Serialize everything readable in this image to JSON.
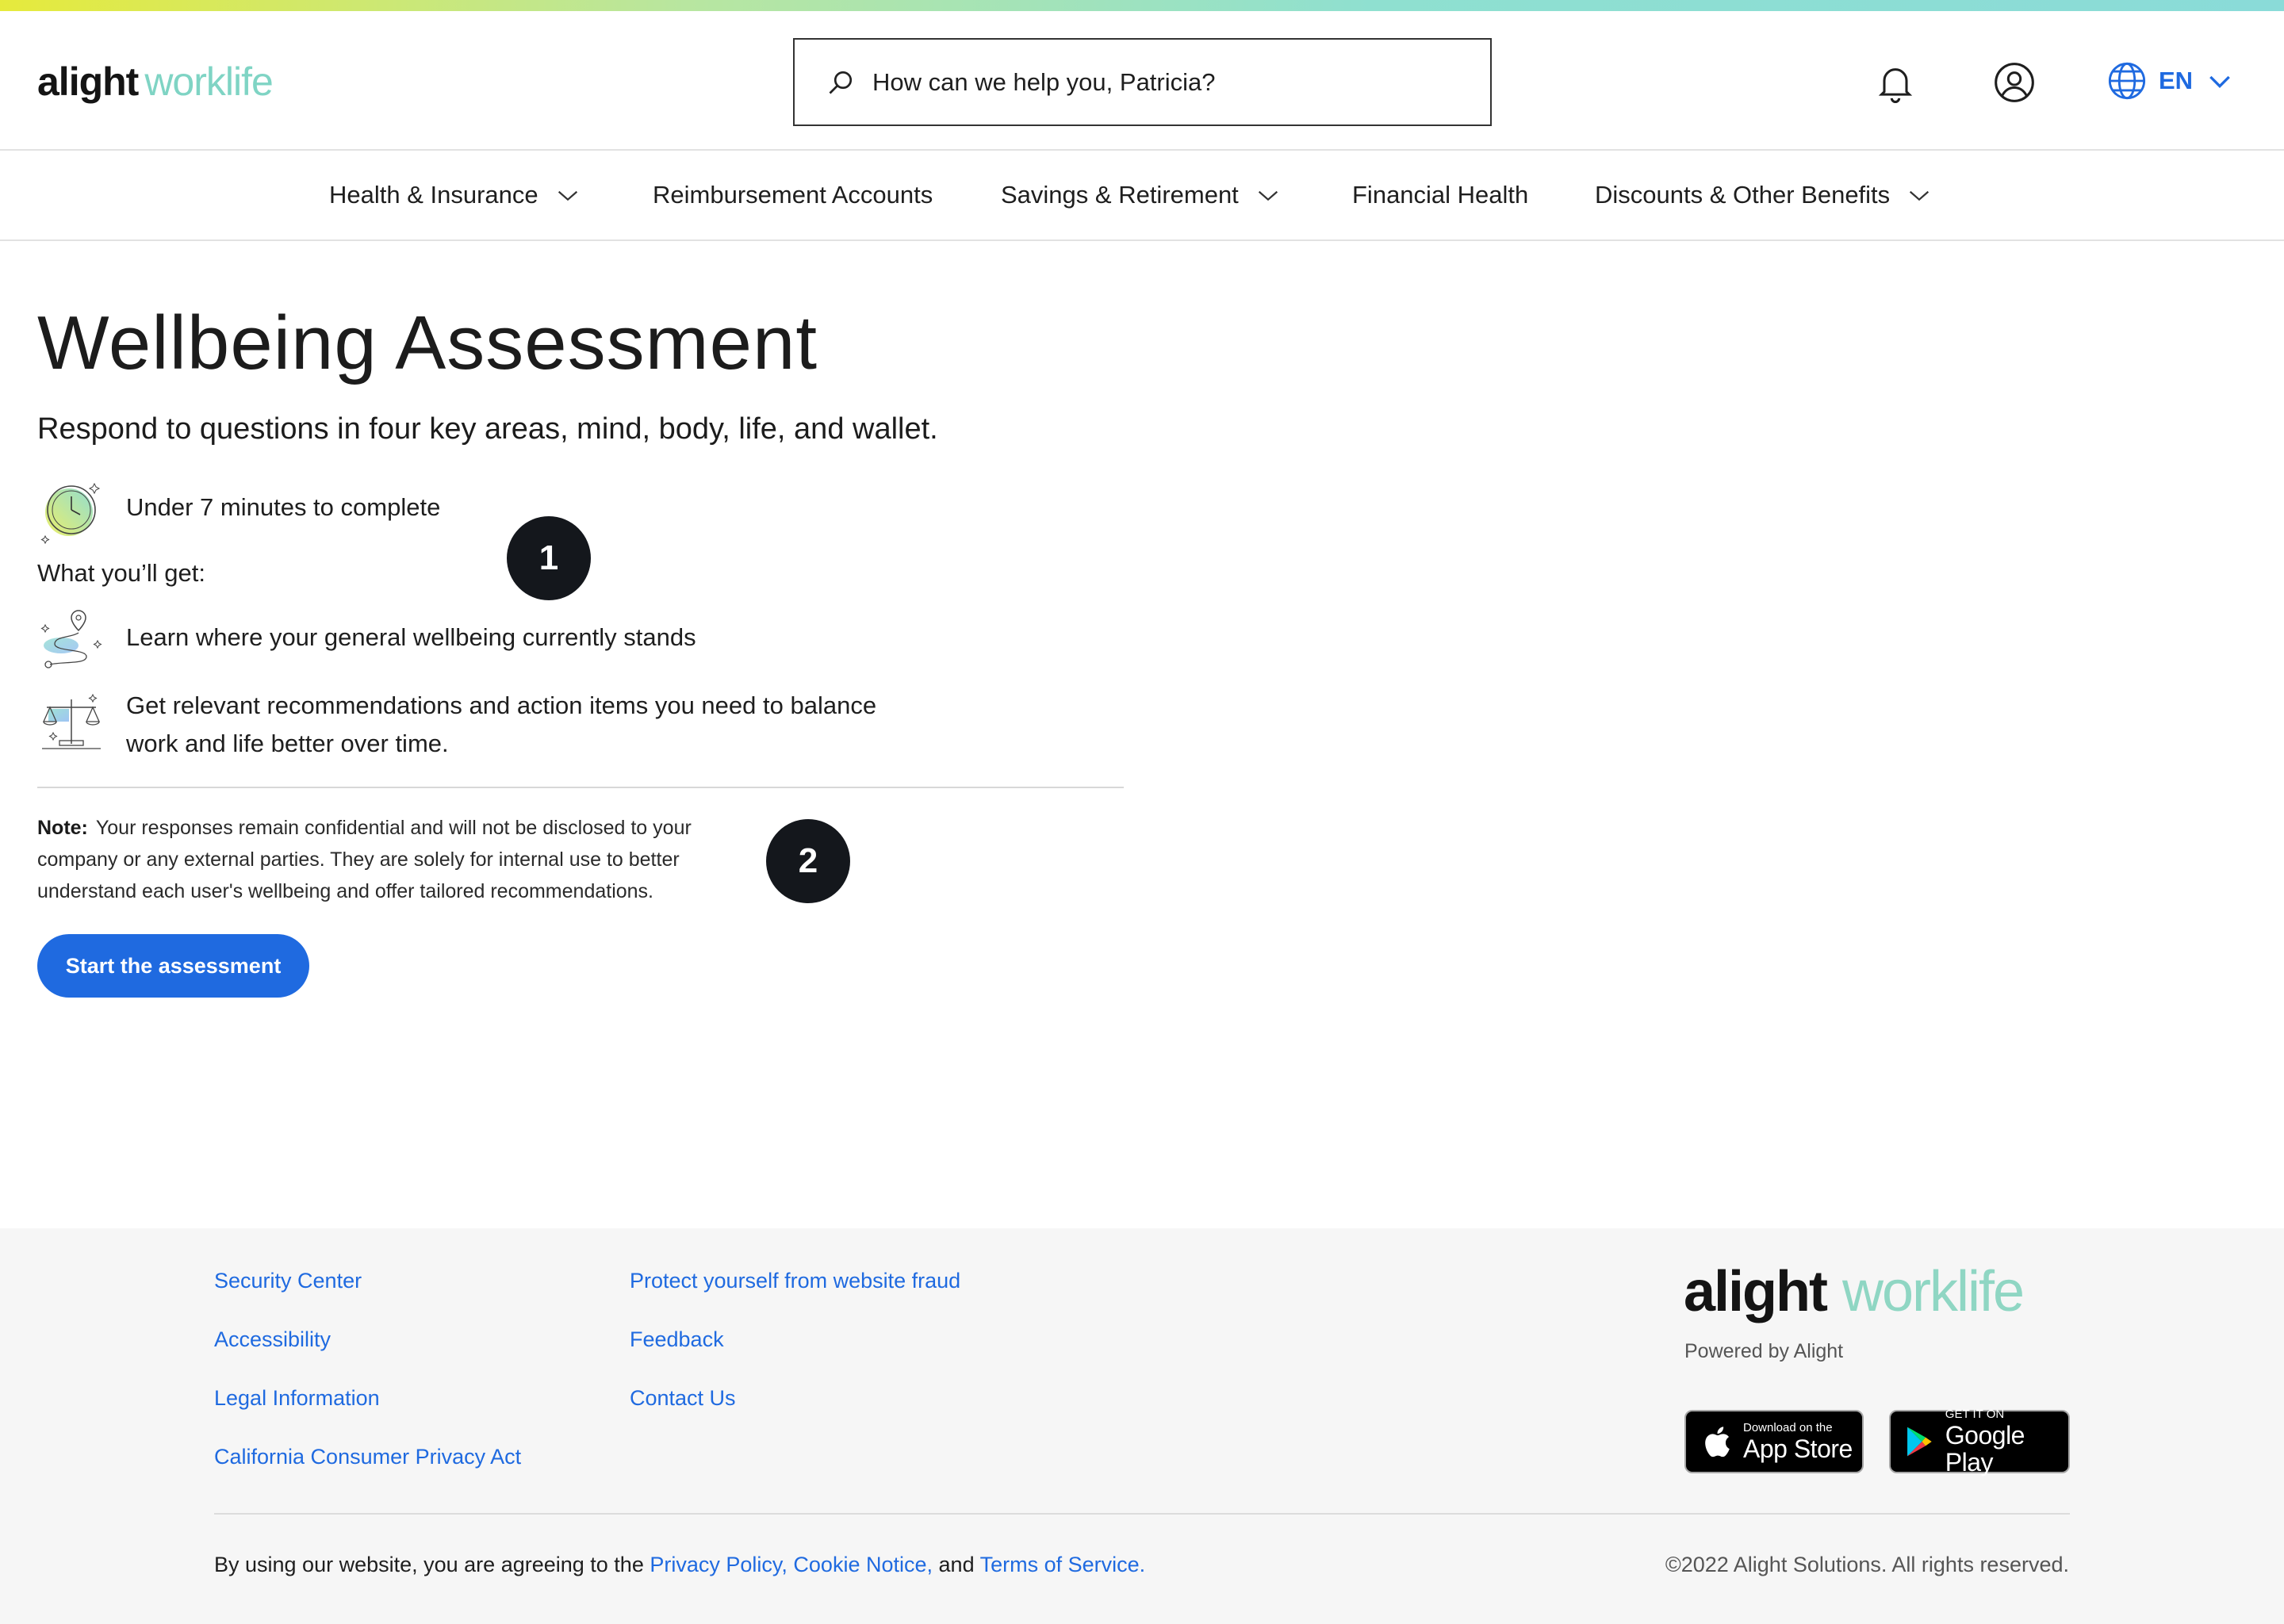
{
  "brand": {
    "alight": "alight",
    "worklife": "worklife"
  },
  "header": {
    "search_placeholder": "How can we help you, Patricia?",
    "language": "EN"
  },
  "nav": {
    "items": [
      {
        "label": "Health & Insurance",
        "has_dropdown": true
      },
      {
        "label": "Reimbursement Accounts",
        "has_dropdown": false
      },
      {
        "label": "Savings & Retirement",
        "has_dropdown": true
      },
      {
        "label": "Financial Health",
        "has_dropdown": false
      },
      {
        "label": "Discounts & Other Benefits",
        "has_dropdown": true
      }
    ]
  },
  "main": {
    "title": "Wellbeing Assessment",
    "lead": "Respond to questions in four key areas, mind, body, life, and wallet.",
    "time_text": "Under 7 minutes to complete",
    "get_label": "What you’ll get:",
    "benefits": [
      "Learn where your general wellbeing currently stands",
      "Get relevant recommendations and action items you need to balance work and life better over time."
    ],
    "benefit_2_line1": "Get relevant recommendations and action items you need to balance",
    "benefit_2_line2": "work and life better over time.",
    "note_label": "Note:",
    "note_text": "Your responses remain confidential and will not be disclosed to your company or any external parties. They are solely for internal use to better understand each user's wellbeing and offer tailored recommendations.",
    "note_line1": "Your responses remain confidential and will not be disclosed to your",
    "note_line2": "company or any external parties. They are solely for internal use to better",
    "note_line3": "understand each user's wellbeing and offer tailored recommendations.",
    "cta": "Start the assessment",
    "markers": [
      "1",
      "2"
    ]
  },
  "footer": {
    "links_col1": [
      "Security Center",
      "Accessibility",
      "Legal Information",
      "California Consumer Privacy Act"
    ],
    "links_col2": [
      "Protect yourself from website fraud",
      "Feedback",
      "Contact Us"
    ],
    "powered_by": "Powered by Alight",
    "app_store": {
      "line1": "Download on the",
      "line2": "App Store"
    },
    "google_play": {
      "line1": "GET IT ON",
      "line2": "Google Play"
    },
    "legal_prefix": "By using our website, you are agreeing to the",
    "privacy_policy": "Privacy Policy,",
    "cookie_notice": "Cookie Notice,",
    "legal_and": "and",
    "terms": "Terms of Service.",
    "copyright": "©2022 Alight Solutions. All rights reserved."
  },
  "colors": {
    "accent": "#1f6ae0",
    "worklife": "#7fd4c4",
    "marker": "#14171c",
    "footer_bg": "#f6f6f6"
  },
  "icons": [
    "search-icon",
    "bell-icon",
    "account-icon",
    "globe-icon",
    "chevron-down-icon",
    "stopwatch-icon",
    "map-pin-path-icon",
    "scales-icon",
    "apple-icon",
    "google-play-icon"
  ]
}
